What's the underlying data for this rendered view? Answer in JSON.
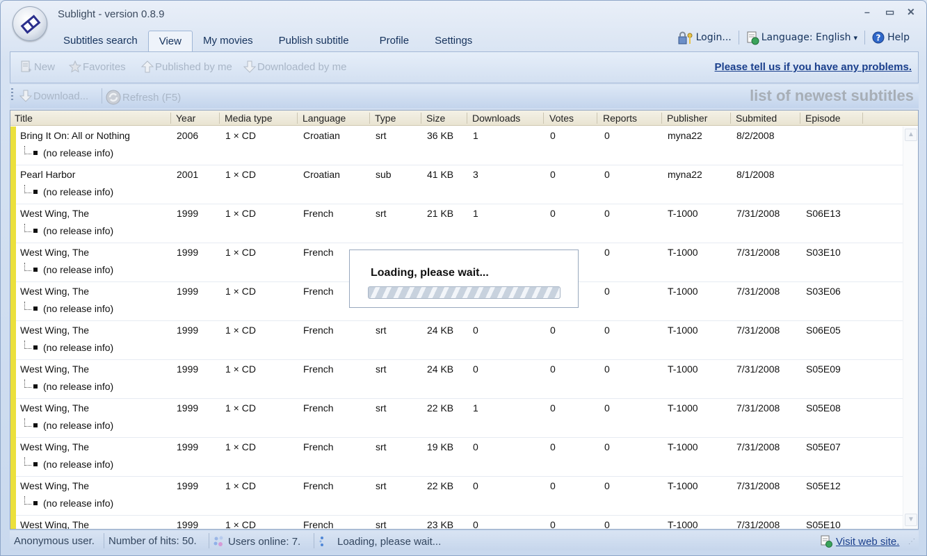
{
  "window": {
    "title": "Sublight - version 0.8.9",
    "controls": {
      "minimize": "–",
      "maximize": "▭",
      "close": "✕"
    }
  },
  "tabs": [
    {
      "label": "Subtitles search",
      "active": false
    },
    {
      "label": "View",
      "active": true
    },
    {
      "label": "My movies",
      "active": false
    },
    {
      "label": "Publish subtitle",
      "active": false
    },
    {
      "label": "Profile",
      "active": false
    },
    {
      "label": "Settings",
      "active": false
    }
  ],
  "topright": {
    "login": "Login...",
    "language": "Language: English",
    "language_caret": "▾",
    "help": "Help"
  },
  "ribbon": {
    "new": "New",
    "favorites": "Favorites",
    "published": "Published by me",
    "downloaded": "Downloaded by me",
    "problem_link": "Please tell us if you have any problems."
  },
  "toolbar": {
    "download": "Download...",
    "refresh": "Refresh (F5)",
    "caption": "list of newest subtitles"
  },
  "grid": {
    "columns": [
      "Title",
      "Year",
      "Media type",
      "Language",
      "Type",
      "Size",
      "Downloads",
      "Votes",
      "Reports",
      "Publisher",
      "Submited",
      "Episode"
    ],
    "release_info": "(no release info)",
    "rows": [
      {
        "title": "Bring It On: All or Nothing",
        "year": "2006",
        "media": "1 × CD",
        "language": "Croatian",
        "type": "srt",
        "size": "36 KB",
        "downloads": "1",
        "votes": "0",
        "reports": "0",
        "publisher": "myna22",
        "submitted": "8/2/2008",
        "episode": ""
      },
      {
        "title": "Pearl Harbor",
        "year": "2001",
        "media": "1 × CD",
        "language": "Croatian",
        "type": "sub",
        "size": "41 KB",
        "downloads": "3",
        "votes": "0",
        "reports": "0",
        "publisher": "myna22",
        "submitted": "8/1/2008",
        "episode": ""
      },
      {
        "title": "West Wing, The",
        "year": "1999",
        "media": "1 × CD",
        "language": "French",
        "type": "srt",
        "size": "21 KB",
        "downloads": "1",
        "votes": "0",
        "reports": "0",
        "publisher": "T-1000",
        "submitted": "7/31/2008",
        "episode": "S06E13"
      },
      {
        "title": "West Wing, The",
        "year": "1999",
        "media": "1 × CD",
        "language": "French",
        "type": "",
        "size": "",
        "downloads": "",
        "votes": "",
        "reports": "0",
        "publisher": "T-1000",
        "submitted": "7/31/2008",
        "episode": "S03E10"
      },
      {
        "title": "West Wing, The",
        "year": "1999",
        "media": "1 × CD",
        "language": "French",
        "type": "",
        "size": "",
        "downloads": "",
        "votes": "",
        "reports": "0",
        "publisher": "T-1000",
        "submitted": "7/31/2008",
        "episode": "S03E06"
      },
      {
        "title": "West Wing, The",
        "year": "1999",
        "media": "1 × CD",
        "language": "French",
        "type": "srt",
        "size": "24 KB",
        "downloads": "0",
        "votes": "0",
        "reports": "0",
        "publisher": "T-1000",
        "submitted": "7/31/2008",
        "episode": "S06E05"
      },
      {
        "title": "West Wing, The",
        "year": "1999",
        "media": "1 × CD",
        "language": "French",
        "type": "srt",
        "size": "24 KB",
        "downloads": "0",
        "votes": "0",
        "reports": "0",
        "publisher": "T-1000",
        "submitted": "7/31/2008",
        "episode": "S05E09"
      },
      {
        "title": "West Wing, The",
        "year": "1999",
        "media": "1 × CD",
        "language": "French",
        "type": "srt",
        "size": "22 KB",
        "downloads": "1",
        "votes": "0",
        "reports": "0",
        "publisher": "T-1000",
        "submitted": "7/31/2008",
        "episode": "S05E08"
      },
      {
        "title": "West Wing, The",
        "year": "1999",
        "media": "1 × CD",
        "language": "French",
        "type": "srt",
        "size": "19 KB",
        "downloads": "0",
        "votes": "0",
        "reports": "0",
        "publisher": "T-1000",
        "submitted": "7/31/2008",
        "episode": "S05E07"
      },
      {
        "title": "West Wing, The",
        "year": "1999",
        "media": "1 × CD",
        "language": "French",
        "type": "srt",
        "size": "22 KB",
        "downloads": "0",
        "votes": "0",
        "reports": "0",
        "publisher": "T-1000",
        "submitted": "7/31/2008",
        "episode": "S05E12"
      },
      {
        "title": "West Wing, The",
        "year": "1999",
        "media": "1 × CD",
        "language": "French",
        "type": "srt",
        "size": "23 KB",
        "downloads": "0",
        "votes": "0",
        "reports": "0",
        "publisher": "T-1000",
        "submitted": "7/31/2008",
        "episode": "S05E10"
      }
    ],
    "row_marker_color": "#ebe03c"
  },
  "loading": {
    "message": "Loading, please wait..."
  },
  "status": {
    "user": "Anonymous user.",
    "hits": "Number of hits: 50.",
    "online": "Users online: 7.",
    "loading": "Loading, please wait...",
    "visit": "Visit web site."
  }
}
